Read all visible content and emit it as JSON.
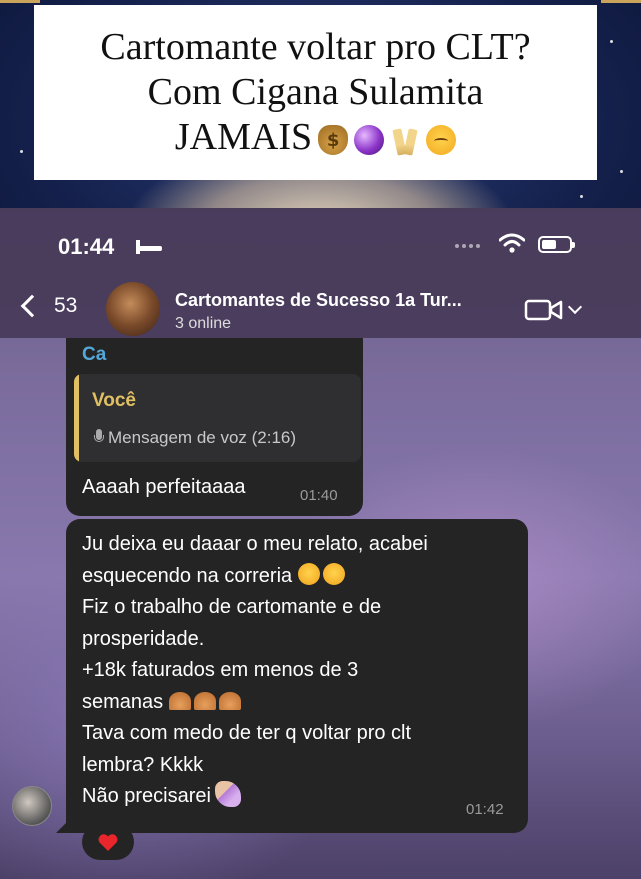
{
  "headline": {
    "line1": "Cartomante voltar pro CLT?",
    "line2": "Com Cigana Sulamita",
    "line3": "JAMAIS",
    "emojis": [
      "money-bag-emoji",
      "crystal-ball-emoji",
      "champagne-glasses-emoji",
      "partying-face-emoji"
    ]
  },
  "status_bar": {
    "time": "01:44",
    "icons": [
      "bed-icon",
      "signal-icon",
      "wifi-icon",
      "battery-icon"
    ]
  },
  "chat_header": {
    "back_count": "53",
    "group_name": "Cartomantes de Sucesso 1a Tur...",
    "members_online": "3 online",
    "icons": [
      "back-chevron-icon",
      "video-call-icon",
      "chevron-down-icon"
    ]
  },
  "messages": [
    {
      "sender": "Ca",
      "quote_author": "Você",
      "quote_text": "Mensagem de voz (2:16)",
      "text": "Aaaah perfeitaaaa",
      "time": "01:40"
    },
    {
      "lines": [
        "Ju deixa eu daaar o meu relato, acabei",
        "esquecendo na correria",
        "Fiz o trabalho de cartomante e de",
        "prosperidade.",
        "+18k faturados em menos de 3",
        "semanas",
        "Tava com medo de ter q voltar pro clt",
        "lembra? Kkkk",
        "Não precisarei"
      ],
      "time": "01:42",
      "reaction": "red-heart"
    }
  ],
  "colors": {
    "bubble": "#242424",
    "sender_name": "#54a7d8",
    "quote_accent": "#e0c062",
    "timestamp": "#9a9a9a"
  }
}
